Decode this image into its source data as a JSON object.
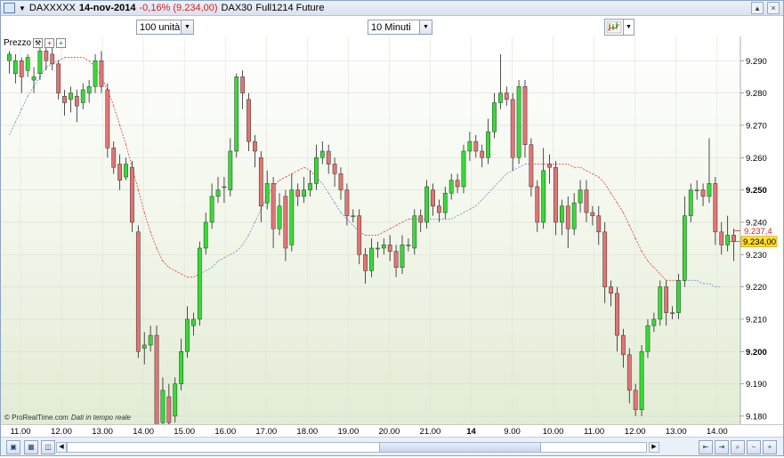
{
  "title_bar": {
    "instrument": "DAXXXXX",
    "date": "14-nov-2014",
    "change": "-0,16% (9.234,00)",
    "market": "DAX30",
    "contract": "Full1214 Future"
  },
  "toolbar": {
    "units_select": "100 unità",
    "timeframe_select": "10 Minuti"
  },
  "panel": {
    "label": "Prezzo"
  },
  "watermark": {
    "brand": "© ProRealTime.com",
    "note": "Dati in tempo reale"
  },
  "colors": {
    "bull": "#33dd33",
    "bear": "#e57373",
    "ma_above": "#e05050",
    "ma_below": "#7799cc",
    "current_price_bg": "#ffdd33",
    "mark_price_color": "#d22020"
  },
  "icons": [
    "instrument-icon",
    "zoom-in-icon",
    "zoom-out-icon",
    "chart-type-icon",
    "scroll-left-icon",
    "scroll-right-icon"
  ],
  "chart_data": {
    "type": "candlestick",
    "ylim": [
      9.1775,
      9.2975
    ],
    "y_ticks": [
      "9.290",
      "9.280",
      "9.270",
      "9.260",
      "9.250",
      "9.240",
      "9.230",
      "9.220",
      "9.210",
      "9.200",
      "9.190",
      "9.180"
    ],
    "x_ticks": [
      "11.00",
      "12.00",
      "13.00",
      "14.00",
      "15.00",
      "16.00",
      "17.00",
      "18.00",
      "19.00",
      "20.00",
      "21.00",
      "14",
      "9.00",
      "10.00",
      "11.00",
      "12.00",
      "13.00",
      "14.00"
    ],
    "current_price": "9.234,00",
    "mark_price": "9.237,4",
    "candles": [
      [
        9.29,
        9.292,
        9.286,
        9.293
      ],
      [
        9.286,
        9.29,
        9.283,
        9.292
      ],
      [
        9.29,
        9.285,
        9.28,
        9.291
      ],
      [
        9.287,
        9.291,
        9.285,
        9.292
      ],
      [
        9.284,
        9.285,
        9.28,
        9.288
      ],
      [
        9.286,
        9.293,
        9.284,
        9.295
      ],
      [
        9.293,
        9.29,
        9.287,
        9.294
      ],
      [
        9.292,
        9.289,
        9.287,
        9.294
      ],
      [
        9.289,
        9.28,
        9.278,
        9.29
      ],
      [
        9.279,
        9.277,
        9.273,
        9.281
      ],
      [
        9.278,
        9.28,
        9.274,
        9.282
      ],
      [
        9.279,
        9.276,
        9.271,
        9.281
      ],
      [
        9.277,
        9.281,
        9.275,
        9.283
      ],
      [
        9.28,
        9.282,
        9.277,
        9.284
      ],
      [
        9.282,
        9.29,
        9.28,
        9.292
      ],
      [
        9.29,
        9.282,
        9.28,
        9.293
      ],
      [
        9.281,
        9.263,
        9.26,
        9.283
      ],
      [
        9.263,
        9.257,
        9.255,
        9.265
      ],
      [
        9.258,
        9.253,
        9.25,
        9.261
      ],
      [
        9.254,
        9.258,
        9.253,
        9.26
      ],
      [
        9.257,
        9.24,
        9.237,
        9.259
      ],
      [
        9.237,
        9.2,
        9.198,
        9.239
      ],
      [
        9.201,
        9.202,
        9.196,
        9.206
      ],
      [
        9.202,
        9.205,
        9.2,
        9.208
      ],
      [
        9.205,
        9.175,
        9.172,
        9.208
      ],
      [
        9.178,
        9.188,
        9.175,
        9.192
      ],
      [
        9.186,
        9.178,
        9.174,
        9.19
      ],
      [
        9.18,
        9.19,
        9.178,
        9.192
      ],
      [
        9.19,
        9.2,
        9.188,
        9.204
      ],
      [
        9.2,
        9.21,
        9.198,
        9.214
      ],
      [
        9.208,
        9.21,
        9.205,
        9.212
      ],
      [
        9.21,
        9.232,
        9.208,
        9.234
      ],
      [
        9.232,
        9.24,
        9.23,
        9.243
      ],
      [
        9.24,
        9.248,
        9.238,
        9.252
      ],
      [
        9.248,
        9.25,
        9.246,
        9.254
      ],
      [
        9.251,
        9.251,
        9.246,
        9.254
      ],
      [
        9.25,
        9.262,
        9.248,
        9.266
      ],
      [
        9.262,
        9.285,
        9.26,
        9.286
      ],
      [
        9.285,
        9.28,
        9.275,
        9.287
      ],
      [
        9.278,
        9.265,
        9.262,
        9.28
      ],
      [
        9.265,
        9.262,
        9.257,
        9.267
      ],
      [
        9.26,
        9.245,
        9.24,
        9.262
      ],
      [
        9.246,
        9.252,
        9.244,
        9.256
      ],
      [
        9.252,
        9.238,
        9.232,
        9.254
      ],
      [
        9.238,
        9.245,
        9.236,
        9.249
      ],
      [
        9.248,
        9.232,
        9.228,
        9.25
      ],
      [
        9.233,
        9.25,
        9.231,
        9.255
      ],
      [
        9.25,
        9.248,
        9.245,
        9.252
      ],
      [
        9.248,
        9.25,
        9.246,
        9.254
      ],
      [
        9.25,
        9.252,
        9.248,
        9.256
      ],
      [
        9.252,
        9.26,
        9.25,
        9.264
      ],
      [
        9.26,
        9.262,
        9.258,
        9.265
      ],
      [
        9.262,
        9.258,
        9.255,
        9.264
      ],
      [
        9.258,
        9.255,
        9.251,
        9.26
      ],
      [
        9.255,
        9.25,
        9.247,
        9.257
      ],
      [
        9.25,
        9.242,
        9.239,
        9.252
      ],
      [
        9.242,
        9.242,
        9.24,
        9.244
      ],
      [
        9.242,
        9.23,
        9.227,
        9.244
      ],
      [
        9.23,
        9.225,
        9.221,
        9.232
      ],
      [
        9.225,
        9.232,
        9.223,
        9.235
      ],
      [
        9.232,
        9.232,
        9.229,
        9.234
      ],
      [
        9.232,
        9.233,
        9.23,
        9.235
      ],
      [
        9.233,
        9.231,
        9.228,
        9.236
      ],
      [
        9.231,
        9.226,
        9.223,
        9.233
      ],
      [
        9.226,
        9.233,
        9.224,
        9.236
      ],
      [
        9.233,
        9.233,
        9.231,
        9.235
      ],
      [
        9.232,
        9.242,
        9.23,
        9.244
      ],
      [
        9.242,
        9.24,
        9.237,
        9.244
      ],
      [
        9.24,
        9.251,
        9.238,
        9.253
      ],
      [
        9.25,
        9.245,
        9.242,
        9.252
      ],
      [
        9.245,
        9.243,
        9.24,
        9.247
      ],
      [
        9.243,
        9.249,
        9.241,
        9.251
      ],
      [
        9.249,
        9.253,
        9.247,
        9.255
      ],
      [
        9.253,
        9.251,
        9.249,
        9.255
      ],
      [
        9.251,
        9.262,
        9.249,
        9.264
      ],
      [
        9.262,
        9.265,
        9.259,
        9.268
      ],
      [
        9.265,
        9.262,
        9.26,
        9.267
      ],
      [
        9.262,
        9.26,
        9.257,
        9.264
      ],
      [
        9.26,
        9.268,
        9.258,
        9.272
      ],
      [
        9.268,
        9.277,
        9.266,
        9.28
      ],
      [
        9.277,
        9.28,
        9.275,
        9.292
      ],
      [
        9.28,
        9.278,
        9.276,
        9.282
      ],
      [
        9.278,
        9.26,
        9.256,
        9.28
      ],
      [
        9.26,
        9.282,
        9.258,
        9.284
      ],
      [
        9.282,
        9.264,
        9.26,
        9.284
      ],
      [
        9.264,
        9.251,
        9.248,
        9.266
      ],
      [
        9.251,
        9.24,
        9.237,
        9.253
      ],
      [
        9.24,
        9.256,
        9.238,
        9.263
      ],
      [
        9.258,
        9.257,
        9.252,
        9.261
      ],
      [
        9.257,
        9.24,
        9.236,
        9.259
      ],
      [
        9.24,
        9.245,
        9.236,
        9.247
      ],
      [
        9.245,
        9.238,
        9.232,
        9.248
      ],
      [
        9.238,
        9.246,
        9.236,
        9.249
      ],
      [
        9.246,
        9.25,
        9.243,
        9.253
      ],
      [
        9.25,
        9.243,
        9.24,
        9.253
      ],
      [
        9.243,
        9.242,
        9.239,
        9.245
      ],
      [
        9.242,
        9.237,
        9.233,
        9.245
      ],
      [
        9.237,
        9.22,
        9.215,
        9.24
      ],
      [
        9.22,
        9.218,
        9.214,
        9.222
      ],
      [
        9.218,
        9.205,
        9.2,
        9.22
      ],
      [
        9.205,
        9.199,
        9.195,
        9.207
      ],
      [
        9.199,
        9.188,
        9.184,
        9.201
      ],
      [
        9.188,
        9.182,
        9.18,
        9.19
      ],
      [
        9.182,
        9.2,
        9.18,
        9.202
      ],
      [
        9.2,
        9.208,
        9.198,
        9.21
      ],
      [
        9.208,
        9.21,
        9.206,
        9.212
      ],
      [
        9.21,
        9.22,
        9.208,
        9.222
      ],
      [
        9.22,
        9.212,
        9.208,
        9.222
      ],
      [
        9.212,
        9.212,
        9.21,
        9.214
      ],
      [
        9.212,
        9.222,
        9.21,
        9.224
      ],
      [
        9.222,
        9.242,
        9.22,
        9.248
      ],
      [
        9.242,
        9.25,
        9.24,
        9.252
      ],
      [
        9.25,
        9.25,
        9.247,
        9.253
      ],
      [
        9.25,
        9.248,
        9.245,
        9.252
      ],
      [
        9.248,
        9.252,
        9.246,
        9.266
      ],
      [
        9.252,
        9.237,
        9.233,
        9.254
      ],
      [
        9.237,
        9.233,
        9.23,
        9.24
      ],
      [
        9.233,
        9.236,
        9.231,
        9.242
      ],
      [
        9.236,
        9.234,
        9.228,
        9.238
      ]
    ],
    "ma": [
      9.267,
      9.271,
      9.275,
      9.279,
      9.282,
      9.285,
      9.288,
      9.289,
      9.29,
      9.291,
      9.291,
      9.291,
      9.291,
      9.29,
      9.288,
      9.285,
      9.281,
      9.276,
      9.27,
      9.264,
      9.257,
      9.25,
      9.243,
      9.237,
      9.232,
      9.228,
      9.226,
      9.225,
      9.224,
      9.223,
      9.223,
      9.224,
      9.225,
      9.226,
      9.228,
      9.229,
      9.23,
      9.231,
      9.233,
      9.236,
      9.24,
      9.244,
      9.248,
      9.251,
      9.253,
      9.254,
      9.255,
      9.256,
      9.257,
      9.256,
      9.254,
      9.252,
      9.249,
      9.246,
      9.243,
      9.241,
      9.239,
      9.237,
      9.236,
      9.236,
      9.236,
      9.237,
      9.238,
      9.239,
      9.24,
      9.241,
      9.241,
      9.241,
      9.241,
      9.241,
      9.241,
      9.241,
      9.241,
      9.242,
      9.243,
      9.244,
      9.245,
      9.247,
      9.249,
      9.251,
      9.253,
      9.255,
      9.256,
      9.257,
      9.258,
      9.258,
      9.258,
      9.258,
      9.258,
      9.258,
      9.258,
      9.258,
      9.257,
      9.257,
      9.256,
      9.255,
      9.254,
      9.252,
      9.249,
      9.246,
      9.243,
      9.239,
      9.235,
      9.231,
      9.228,
      9.226,
      9.224,
      9.222,
      9.222,
      9.222,
      9.222,
      9.222,
      9.222,
      9.221,
      9.221,
      9.22,
      9.22
    ]
  }
}
